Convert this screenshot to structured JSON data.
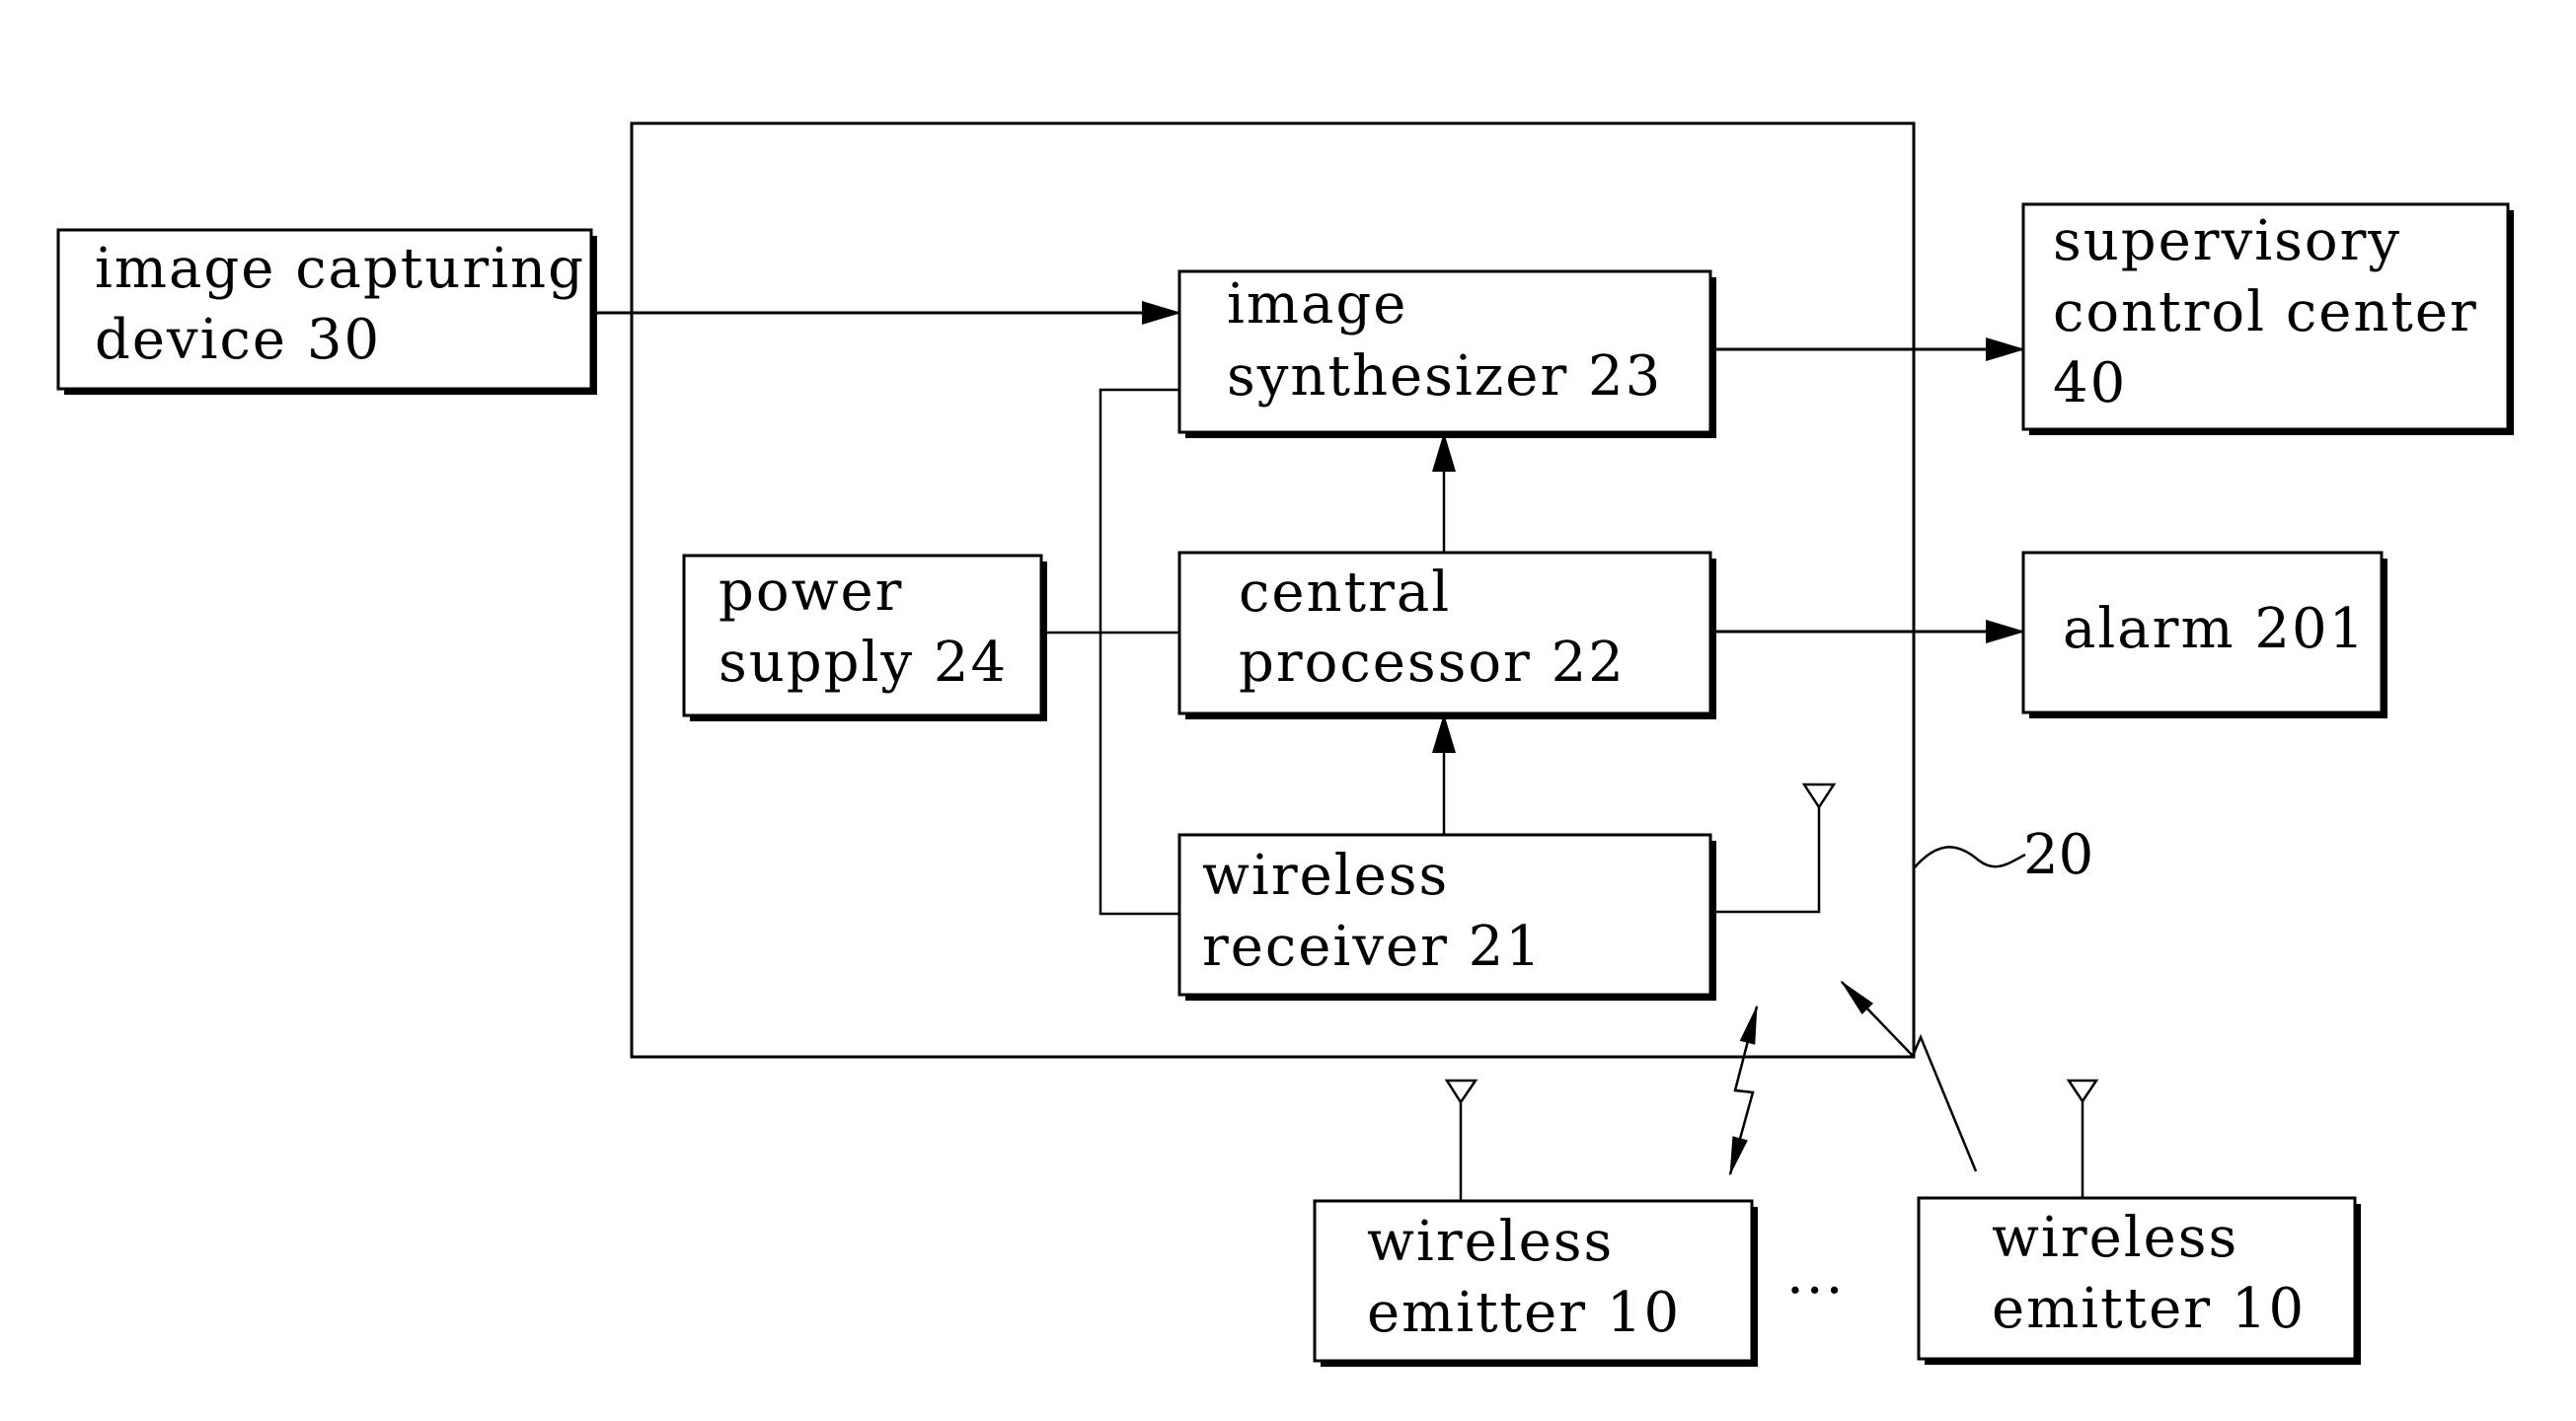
{
  "diagram": {
    "system_ref": "20",
    "blocks": {
      "image_capturing_device": {
        "lines": [
          "image capturing",
          "device 30"
        ]
      },
      "image_synthesizer": {
        "lines": [
          "image",
          "synthesizer 23"
        ]
      },
      "central_processor": {
        "lines": [
          "central",
          "processor 22"
        ]
      },
      "wireless_receiver": {
        "lines": [
          "wireless",
          "receiver 21"
        ]
      },
      "power_supply": {
        "lines": [
          "power",
          "supply 24"
        ]
      },
      "supervisory_control_center": {
        "lines": [
          "supervisory",
          "control center",
          "40"
        ]
      },
      "alarm": {
        "lines": [
          "alarm 201"
        ]
      },
      "wireless_emitter_1": {
        "lines": [
          "wireless",
          "emitter 10"
        ]
      },
      "wireless_emitter_2": {
        "lines": [
          "wireless",
          "emitter 10"
        ]
      }
    },
    "ellipsis": "...",
    "connections": [
      {
        "from": "image capturing device 30",
        "to": "image synthesizer 23",
        "type": "arrow"
      },
      {
        "from": "image synthesizer 23",
        "to": "supervisory control center 40",
        "type": "arrow"
      },
      {
        "from": "central processor 22",
        "to": "image synthesizer 23",
        "type": "arrow"
      },
      {
        "from": "central processor 22",
        "to": "alarm 201",
        "type": "arrow"
      },
      {
        "from": "wireless receiver 21",
        "to": "central processor 22",
        "type": "arrow"
      },
      {
        "from": "power supply 24",
        "to": "central processor 22",
        "type": "line"
      },
      {
        "from": "power supply 24",
        "to": "image synthesizer 23",
        "type": "line"
      },
      {
        "from": "power supply 24",
        "to": "wireless receiver 21",
        "type": "line"
      },
      {
        "from": "wireless emitter 10",
        "to": "wireless receiver 21",
        "type": "wireless-bidirectional"
      },
      {
        "from": "wireless emitter 10",
        "to": "wireless receiver 21",
        "type": "wireless"
      }
    ]
  }
}
